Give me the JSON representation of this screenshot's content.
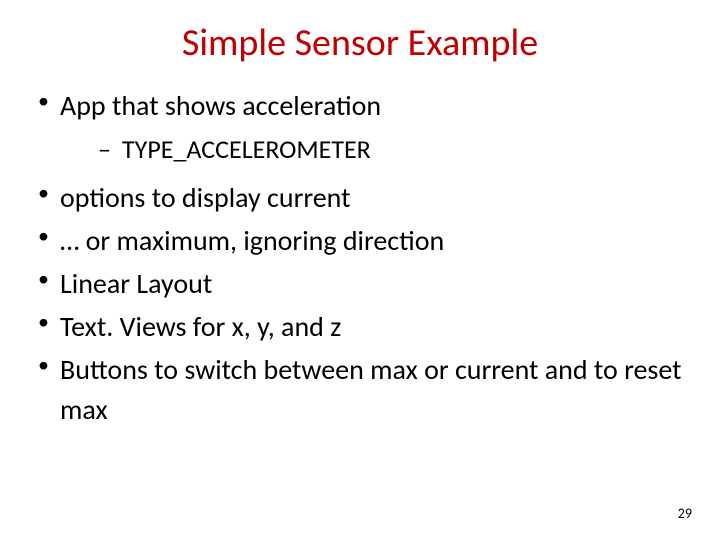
{
  "title": "Simple Sensor Example",
  "bullets": [
    {
      "text": "App that shows acceleration",
      "sub": [
        "TYPE_ACCELEROMETER"
      ]
    },
    {
      "text": "options to display current"
    },
    {
      "text": "… or maximum, ignoring direction"
    },
    {
      "text": "Linear Layout"
    },
    {
      "text": "Text. Views for x, y, and z"
    },
    {
      "text": "Buttons to switch between max or current and to reset max"
    }
  ],
  "page_number": "29"
}
